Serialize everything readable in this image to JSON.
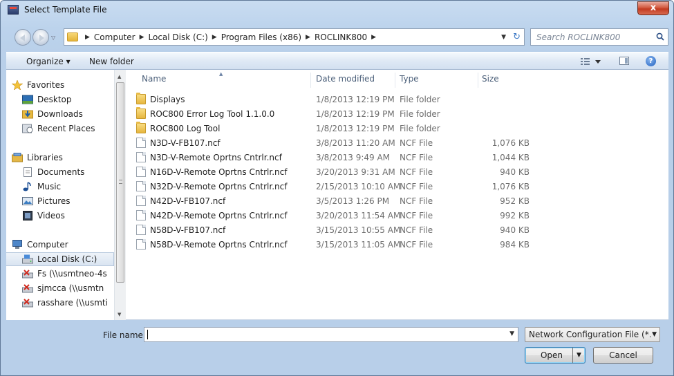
{
  "window": {
    "title": "Select Template File",
    "close_label": "x"
  },
  "address": {
    "crumbs": [
      "Computer",
      "Local Disk (C:)",
      "Program Files (x86)",
      "ROCLINK800"
    ],
    "search_placeholder": "Search ROCLINK800"
  },
  "toolbar": {
    "organize": "Organize ▾",
    "new_folder": "New folder",
    "help": "?"
  },
  "nav": {
    "favorites": "Favorites",
    "desktop": "Desktop",
    "downloads": "Downloads",
    "recent_places": "Recent Places",
    "libraries": "Libraries",
    "documents": "Documents",
    "music": "Music",
    "pictures": "Pictures",
    "videos": "Videos",
    "computer": "Computer",
    "local_disk": "Local Disk (C:)",
    "fs": "Fs (\\\\usmtneo-4s",
    "sjmcca": "sjmcca (\\\\usmtn",
    "rasshare": "rasshare (\\\\usmti"
  },
  "columns": {
    "name": "Name",
    "date": "Date modified",
    "type": "Type",
    "size": "Size"
  },
  "files": [
    {
      "kind": "folder",
      "name": "Displays",
      "date": "1/8/2013 12:19 PM",
      "type": "File folder",
      "size": ""
    },
    {
      "kind": "folder",
      "name": "ROC800 Error Log Tool 1.1.0.0",
      "date": "1/8/2013 12:19 PM",
      "type": "File folder",
      "size": ""
    },
    {
      "kind": "folder",
      "name": "ROC800 Log Tool",
      "date": "1/8/2013 12:19 PM",
      "type": "File folder",
      "size": ""
    },
    {
      "kind": "file",
      "name": "N3D-V-FB107.ncf",
      "date": "3/8/2013 11:20 AM",
      "type": "NCF File",
      "size": "1,076 KB"
    },
    {
      "kind": "file",
      "name": "N3D-V-Remote Oprtns Cntrlr.ncf",
      "date": "3/8/2013 9:49 AM",
      "type": "NCF File",
      "size": "1,044 KB"
    },
    {
      "kind": "file",
      "name": "N16D-V-Remote Oprtns Cntrlr.ncf",
      "date": "3/20/2013 9:31 AM",
      "type": "NCF File",
      "size": "940 KB"
    },
    {
      "kind": "file",
      "name": "N32D-V-Remote Oprtns Cntrlr.ncf",
      "date": "2/15/2013 10:10 AM",
      "type": "NCF File",
      "size": "1,076 KB"
    },
    {
      "kind": "file",
      "name": "N42D-V-FB107.ncf",
      "date": "3/5/2013 1:26 PM",
      "type": "NCF File",
      "size": "952 KB"
    },
    {
      "kind": "file",
      "name": "N42D-V-Remote Oprtns Cntrlr.ncf",
      "date": "3/20/2013 11:54 AM",
      "type": "NCF File",
      "size": "992 KB"
    },
    {
      "kind": "file",
      "name": "N58D-V-FB107.ncf",
      "date": "3/15/2013 10:55 AM",
      "type": "NCF File",
      "size": "940 KB"
    },
    {
      "kind": "file",
      "name": "N58D-V-Remote Oprtns Cntrlr.ncf",
      "date": "3/15/2013 11:05 AM",
      "type": "NCF File",
      "size": "984 KB"
    }
  ],
  "bottom": {
    "file_name_label": "File name:",
    "file_name_value": "",
    "filter_value": "Network Configuration File (*.n",
    "open_label": "Open",
    "cancel_label": "Cancel"
  }
}
